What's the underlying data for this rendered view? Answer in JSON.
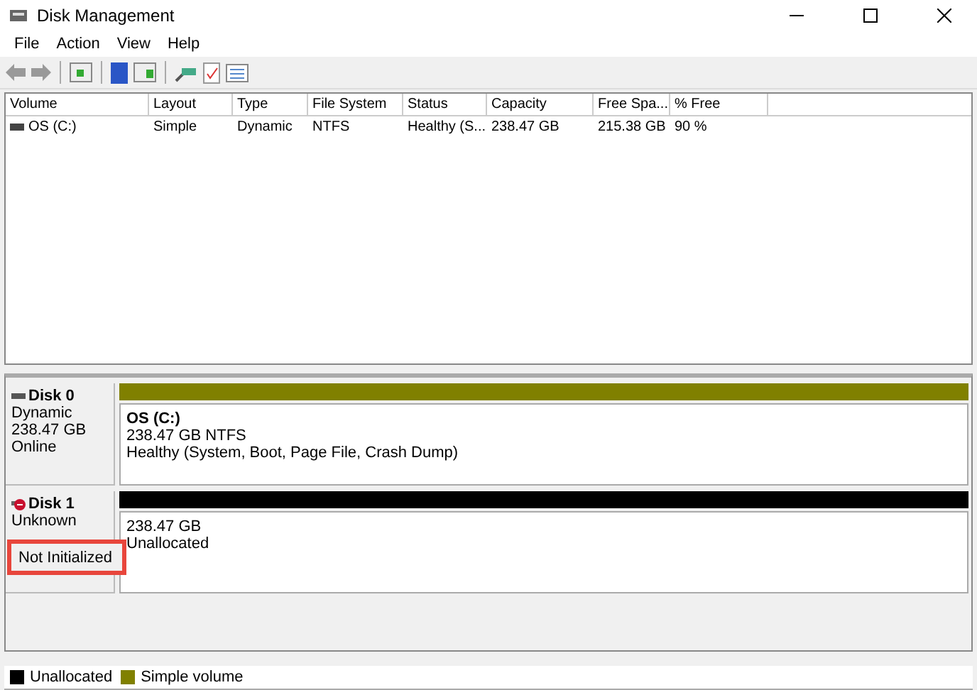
{
  "window": {
    "title": "Disk Management"
  },
  "menu": [
    "File",
    "Action",
    "View",
    "Help"
  ],
  "table": {
    "columns": [
      "Volume",
      "Layout",
      "Type",
      "File System",
      "Status",
      "Capacity",
      "Free Spa...",
      "% Free"
    ],
    "rows": [
      {
        "cells": [
          "OS (C:)",
          "Simple",
          "Dynamic",
          "NTFS",
          "Healthy (S...",
          "238.47 GB",
          "215.38 GB",
          "90 %"
        ]
      }
    ]
  },
  "disks": [
    {
      "name": "Disk 0",
      "kind": "online",
      "lines": [
        "Dynamic",
        "238.47 GB",
        "Online"
      ],
      "partition": {
        "color": "#808000",
        "title": "OS  (C:)",
        "lines": [
          "238.47 GB NTFS",
          "Healthy (System, Boot, Page File, Crash Dump)"
        ]
      }
    },
    {
      "name": "Disk 1",
      "kind": "error",
      "lines": [
        "Unknown"
      ],
      "highlight": "Not Initialized",
      "partition": {
        "color": "#000000",
        "lines": [
          "238.47 GB",
          "Unallocated"
        ]
      }
    }
  ],
  "legend": [
    {
      "label": "Unallocated",
      "color": "#000000"
    },
    {
      "label": "Simple volume",
      "color": "#808000"
    }
  ]
}
